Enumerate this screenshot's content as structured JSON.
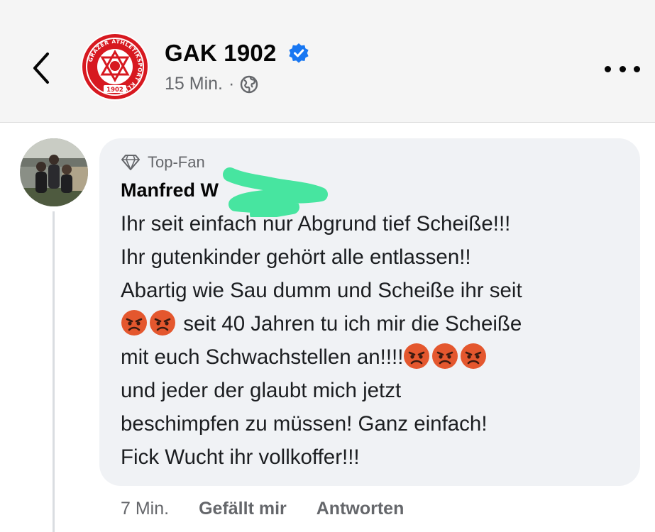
{
  "header": {
    "page_name": "GAK 1902",
    "logo_ring_text": "GRAZER ATHLETIKSPORT KLUB",
    "logo_year": "1902",
    "time": "15 Min.",
    "separator": "·",
    "icons": {
      "back": "chevron-left-icon",
      "verified": "verified-badge-icon",
      "audience": "globe-icon",
      "more": "more-options-icon"
    }
  },
  "comment": {
    "badge_label": "Top-Fan",
    "author": "Manfred W",
    "lines": [
      {
        "text": "Ihr seit einfach nur Abgrund tief Scheiße!!!"
      },
      {
        "text": "Ihr gutenkinder gehört alle entlassen!!"
      },
      {
        "text": "Abartig wie Sau dumm und Scheiße ihr seit"
      },
      {
        "text": " seit 40 Jahren tu ich mir die Scheiße"
      },
      {
        "text": "mit euch Schwachstellen an!!!!"
      },
      {
        "text": "und jeder der glaubt mich jetzt"
      },
      {
        "text": "beschimpfen zu müssen! Ganz einfach!"
      },
      {
        "text": "Fick Wucht ihr vollkoffer!!!"
      }
    ],
    "emoji": "angry-face-icon"
  },
  "footer": {
    "time": "7 Min.",
    "like_label": "Gefällt mir",
    "reply_label": "Antworten"
  },
  "colors": {
    "header_bg": "#f5f5f5",
    "bubble_bg": "#f0f2f5",
    "secondary_text": "#65676b",
    "verified_blue": "#1877f2",
    "logo_red": "#d71920",
    "redaction_green": "#3de49b",
    "emoji_red": "#e4572e"
  }
}
